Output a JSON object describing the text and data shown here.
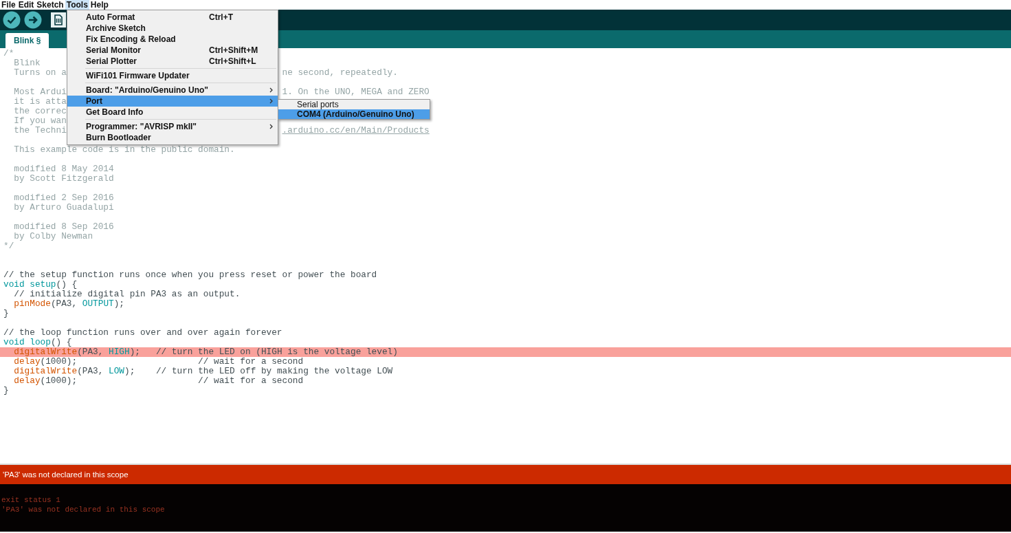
{
  "menubar": [
    {
      "label": "File",
      "selected": false
    },
    {
      "label": "Edit",
      "selected": false
    },
    {
      "label": "Sketch",
      "selected": false
    },
    {
      "label": "Tools",
      "selected": true
    },
    {
      "label": "Help",
      "selected": false
    }
  ],
  "toolbar": [
    {
      "kind": "verify"
    },
    {
      "kind": "upload"
    },
    {
      "kind": "new"
    }
  ],
  "tabs": [
    {
      "label": "Blink §",
      "selected": true
    }
  ],
  "editor": {
    "lines": [
      {
        "highlighted": false,
        "tokens": [
          {
            "text": "/*",
            "kind": "comment"
          }
        ]
      },
      {
        "highlighted": false,
        "tokens": [
          {
            "text": "  Blink",
            "kind": "comment"
          }
        ]
      },
      {
        "highlighted": false,
        "tokens": [
          {
            "text": "  Turns on a",
            "kind": "comment"
          }
        ],
        "tail": [
          {
            "text": "ne second, repeatedly.",
            "kind": "comment"
          }
        ]
      },
      {
        "highlighted": false
      },
      {
        "highlighted": false,
        "tokens": [
          {
            "text": "  Most Ardui",
            "kind": "comment"
          }
        ],
        "tail": [
          {
            "text": "1. On the UNO, MEGA and ZERO",
            "kind": "comment"
          }
        ]
      },
      {
        "highlighted": false,
        "tokens": [
          {
            "text": "  it is atta",
            "kind": "comment"
          }
        ]
      },
      {
        "highlighted": false,
        "tokens": [
          {
            "text": "  the correc",
            "kind": "comment"
          }
        ]
      },
      {
        "highlighted": false,
        "tokens": [
          {
            "text": "  If you wan",
            "kind": "comment"
          }
        ]
      },
      {
        "highlighted": false,
        "tokens": [
          {
            "text": "  the Techni",
            "kind": "comment"
          }
        ],
        "tail": [
          {
            "text": ".arduino.cc/en/Main/Products",
            "kind": "link"
          }
        ]
      },
      {
        "highlighted": false
      },
      {
        "highlighted": false,
        "tokens": [
          {
            "text": "  This example code is in the public domain.",
            "kind": "comment"
          }
        ]
      },
      {
        "highlighted": false
      },
      {
        "highlighted": false,
        "tokens": [
          {
            "text": "  modified 8 May 2014",
            "kind": "comment"
          }
        ]
      },
      {
        "highlighted": false,
        "tokens": [
          {
            "text": "  by Scott Fitzgerald",
            "kind": "comment"
          }
        ]
      },
      {
        "highlighted": false
      },
      {
        "highlighted": false,
        "tokens": [
          {
            "text": "  modified 2 Sep 2016",
            "kind": "comment"
          }
        ]
      },
      {
        "highlighted": false,
        "tokens": [
          {
            "text": "  by Arturo Guadalupi",
            "kind": "comment"
          }
        ]
      },
      {
        "highlighted": false
      },
      {
        "highlighted": false,
        "tokens": [
          {
            "text": "  modified 8 Sep 2016",
            "kind": "comment"
          }
        ]
      },
      {
        "highlighted": false,
        "tokens": [
          {
            "text": "  by Colby Newman",
            "kind": "comment"
          }
        ]
      },
      {
        "highlighted": false,
        "tokens": [
          {
            "text": "*/",
            "kind": "comment"
          }
        ]
      },
      {
        "highlighted": false
      },
      {
        "highlighted": false
      },
      {
        "highlighted": false,
        "tokens": [
          {
            "text": "// the setup function runs once when you press reset or power the board",
            "kind": "line_comment"
          }
        ]
      },
      {
        "highlighted": false,
        "tokens": [
          {
            "text": "void setup",
            "kind": "keyword"
          },
          {
            "text": "() {",
            "kind": "plain"
          }
        ]
      },
      {
        "highlighted": false,
        "tokens": [
          {
            "text": "  // initialize digital pin PA3 as an output.",
            "kind": "line_comment"
          }
        ]
      },
      {
        "highlighted": false,
        "tokens": [
          {
            "text": "  pinMode",
            "kind": "function"
          },
          {
            "text": "(PA3, ",
            "kind": "plain"
          },
          {
            "text": "OUTPUT",
            "kind": "constant"
          },
          {
            "text": ");",
            "kind": "plain"
          }
        ]
      },
      {
        "highlighted": false,
        "tokens": [
          {
            "text": "}",
            "kind": "plain"
          }
        ]
      },
      {
        "highlighted": false
      },
      {
        "highlighted": false,
        "tokens": [
          {
            "text": "// the loop function runs over and over again forever",
            "kind": "line_comment"
          }
        ]
      },
      {
        "highlighted": false,
        "tokens": [
          {
            "text": "void loop",
            "kind": "keyword"
          },
          {
            "text": "() {",
            "kind": "plain"
          }
        ]
      },
      {
        "highlighted": true,
        "tokens": [
          {
            "text": "  digitalWrite",
            "kind": "function"
          },
          {
            "text": "(PA3, ",
            "kind": "plain"
          },
          {
            "text": "HIGH",
            "kind": "constant"
          },
          {
            "text": ");   // turn the LED on (HIGH is the voltage level)",
            "kind": "plain"
          }
        ]
      },
      {
        "highlighted": false,
        "tokens": [
          {
            "text": "  delay",
            "kind": "function"
          },
          {
            "text": "(1000);                       // wait for a second",
            "kind": "plain"
          }
        ]
      },
      {
        "highlighted": false,
        "tokens": [
          {
            "text": "  digitalWrite",
            "kind": "function"
          },
          {
            "text": "(PA3, ",
            "kind": "plain"
          },
          {
            "text": "LOW",
            "kind": "constant"
          },
          {
            "text": ");    // turn the LED off by making the voltage LOW",
            "kind": "plain"
          }
        ]
      },
      {
        "highlighted": false,
        "tokens": [
          {
            "text": "  delay",
            "kind": "function"
          },
          {
            "text": "(1000);                       // wait for a second",
            "kind": "plain"
          }
        ]
      },
      {
        "highlighted": false,
        "tokens": [
          {
            "text": "}",
            "kind": "plain"
          }
        ]
      }
    ]
  },
  "menu": {
    "items": [
      {
        "kind": "item",
        "label": "Auto Format",
        "shortcut": "Ctrl+T",
        "submenu": false,
        "selected": false
      },
      {
        "kind": "item",
        "label": "Archive Sketch",
        "submenu": false,
        "selected": false
      },
      {
        "kind": "item",
        "label": "Fix Encoding & Reload",
        "submenu": false,
        "selected": false
      },
      {
        "kind": "item",
        "label": "Serial Monitor",
        "shortcut": "Ctrl+Shift+M",
        "submenu": false,
        "selected": false
      },
      {
        "kind": "item",
        "label": "Serial Plotter",
        "shortcut": "Ctrl+Shift+L",
        "submenu": false,
        "selected": false
      },
      {
        "kind": "separator"
      },
      {
        "kind": "item",
        "label": "WiFi101 Firmware Updater",
        "submenu": false,
        "selected": false
      },
      {
        "kind": "separator"
      },
      {
        "kind": "item",
        "label": "Board: \"Arduino/Genuino Uno\"",
        "submenu": true,
        "selected": false
      },
      {
        "kind": "item",
        "label": "Port",
        "submenu": true,
        "selected": true
      },
      {
        "kind": "item",
        "label": "Get Board Info",
        "submenu": false,
        "selected": false
      },
      {
        "kind": "separator"
      },
      {
        "kind": "item",
        "label": "Programmer: \"AVRISP mkII\"",
        "submenu": true,
        "selected": false
      },
      {
        "kind": "item",
        "label": "Burn Bootloader",
        "submenu": false,
        "selected": false
      }
    ]
  },
  "submenu": {
    "items": [
      {
        "kind": "header",
        "label": "Serial ports",
        "selected": false
      },
      {
        "kind": "item",
        "label": "COM4 (Arduino/Genuino Uno)",
        "selected": true
      }
    ]
  },
  "error_bar": {
    "message": "'PA3' was not declared in this scope"
  },
  "console": {
    "lines": [
      "exit status 1",
      "'PA3' was not declared in this scope"
    ]
  }
}
